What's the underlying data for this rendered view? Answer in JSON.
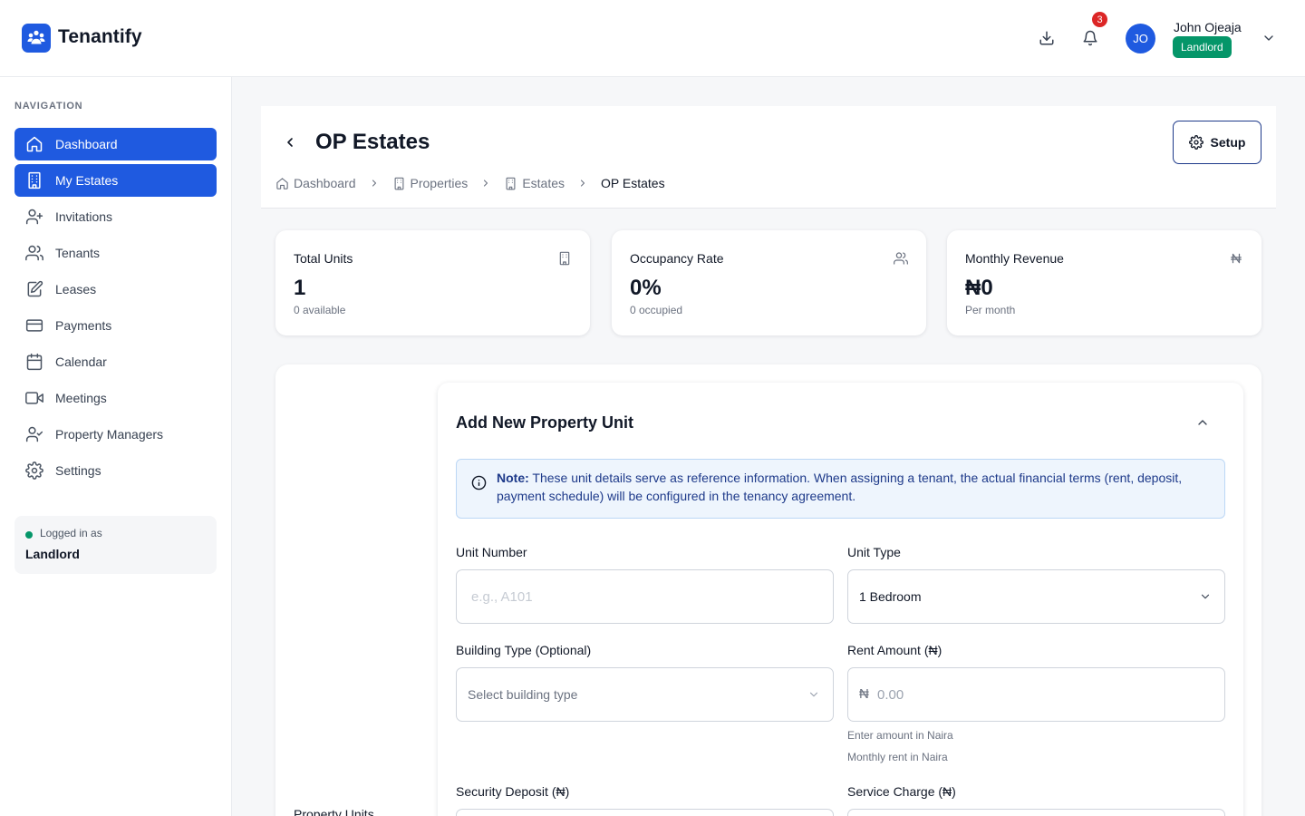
{
  "app": {
    "name": "Tenantify",
    "brand_color": "#1f5ae0"
  },
  "header": {
    "notification_count": "3",
    "user": {
      "initials": "JO",
      "name": "John Ojeaja",
      "role": "Landlord"
    },
    "icons": [
      "download-icon",
      "bell-icon",
      "chevron-down-icon"
    ]
  },
  "sidebar": {
    "heading": "NAVIGATION",
    "items": [
      {
        "label": "Dashboard",
        "icon": "home-icon",
        "active": true
      },
      {
        "label": "My Estates",
        "icon": "building-icon",
        "active": true
      },
      {
        "label": "Invitations",
        "icon": "user-plus-icon",
        "active": false
      },
      {
        "label": "Tenants",
        "icon": "users-icon",
        "active": false
      },
      {
        "label": "Leases",
        "icon": "document-edit-icon",
        "active": false
      },
      {
        "label": "Payments",
        "icon": "credit-card-icon",
        "active": false
      },
      {
        "label": "Calendar",
        "icon": "calendar-icon",
        "active": false
      },
      {
        "label": "Meetings",
        "icon": "video-icon",
        "active": false
      },
      {
        "label": "Property Managers",
        "icon": "user-check-icon",
        "active": false
      },
      {
        "label": "Settings",
        "icon": "gear-icon",
        "active": false
      }
    ],
    "logged_in": {
      "label": "Logged in as",
      "role": "Landlord"
    }
  },
  "page": {
    "title": "OP Estates",
    "setup_label": "Setup",
    "breadcrumb": [
      {
        "label": "Dashboard",
        "icon": "home-icon"
      },
      {
        "label": "Properties",
        "icon": "building-icon"
      },
      {
        "label": "Estates",
        "icon": "building-icon"
      },
      {
        "label": "OP Estates",
        "icon": ""
      }
    ]
  },
  "stats": [
    {
      "label": "Total Units",
      "value": "1",
      "sub": "0 available",
      "icon": "building-icon"
    },
    {
      "label": "Occupancy Rate",
      "value": "0%",
      "sub": "0 occupied",
      "icon": "users-icon"
    },
    {
      "label": "Monthly Revenue",
      "value": "₦0",
      "sub": "Per month",
      "icon": "naira-icon"
    }
  ],
  "panel": {
    "side_label": "Property Units"
  },
  "form": {
    "title": "Add New Property Unit",
    "note_prefix": "Note:",
    "note_text": "These unit details serve as reference information. When assigning a tenant, the actual financial terms (rent, deposit, payment schedule) will be configured in the tenancy agreement.",
    "unit_number": {
      "label": "Unit Number",
      "placeholder": "e.g., A101",
      "value": ""
    },
    "unit_type": {
      "label": "Unit Type",
      "value": "1 Bedroom"
    },
    "building_type": {
      "label": "Building Type (Optional)",
      "placeholder": "Select building type"
    },
    "rent_amount": {
      "label": "Rent Amount (₦)",
      "symbol": "₦",
      "placeholder": "0.00",
      "hint1": "Enter amount in Naira",
      "hint2": "Monthly rent in Naira"
    },
    "security_deposit": {
      "label": "Security Deposit (₦)"
    },
    "service_charge": {
      "label": "Service Charge (₦)"
    }
  }
}
